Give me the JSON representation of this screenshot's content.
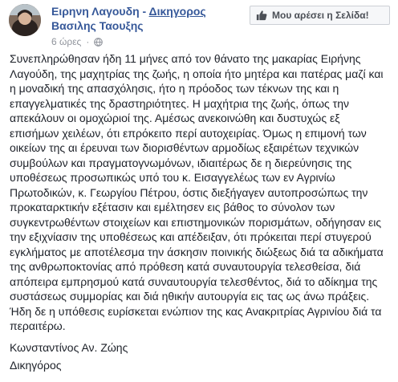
{
  "post": {
    "author_name": "Ειρηνη Λαγουδη",
    "author_separator": " - ",
    "author_role": "Δικηγορος",
    "author_line2": "Βασιλης Ταουξης",
    "time": "6 ώρες",
    "privacy_icon": "globe-icon"
  },
  "like_page_button": {
    "label": "Μου αρέσει η Σελίδα!",
    "icon": "thumbs-up-icon"
  },
  "body": {
    "paragraph1": "Συνεπληρώθησαν ήδη 11 μήνες από τον θάνατο της μακαρίας Ειρήνης\nΛαγούδη, της μαχητρίας της ζωής, η οποία ήτο μητέρα και πατέρας μαζί και\nη μοναδική της απασχόλησις, ήτο η πρόοδος των τέκνων της και η\nεπαγγελματικές της δραστηριότητες. Η μαχήτρια της ζωής, όπως την\nαπεκάλουν οι ομοχώριοί της. Αμέσως ανεκοινώθη και δυστυχώς εξ\nεπισήμων χειλέων, ότι επρόκειτο περί αυτοχειρίας. Όμως η επιμονή των\nοικείων της αι έρευναι των διορισθέντων αρμοδίως εξαιρέτων τεχνικών\nσυμβούλων και πραγματογνωμόνων, ιδιαιτέρως δε η διερεύνησις της\nυποθέσεως προσωπικώς υπό του κ. Εισαγγελέως των εν Αγρινίω\nΠρωτοδικών, κ. Γεωργίου Πέτρου, όστις διεξήγαγεν αυτοπροσώπως την\nπροκαταρκτικήν εξέτασιν και εμέλτησεν εις βάθος το σύνολον των\nσυγκεντρωθέντων στοιχείων και επιστημονικών πορισμάτων, οδήγησαν εις\nτην εξιχνίασιν της υποθέσεως και απέδειξαν, ότι πρόκειται περί στυγερού\nεγκλήματος με αποτέλεσμα την άσκησιν ποινικής διώξεως διά τα αδικήματα\nτης ανθρωποκτονίας από πρόθεση κατά συναυτουργία τελεσθείσα, διά\nαπόπειρα εμπρησμού κατά συναυτουργία τελεσθέντος, διά το αδίκημα της\nσυστάσεως συμμορίας και διά ηθικήν αυτουργία εις τας ως άνω πράξεις.\nΉδη δε η υπόθεσις ευρίσκεται ενώπιον της κας Ανακριτρίας Αγρινίου διά τα\nπεραιτέρω.",
    "signature_name": "Κωνσταντίνος Αν. Ζώης",
    "signature_title": "Δικηγόρος"
  },
  "colors": {
    "link": "#365899",
    "text": "#1d2129",
    "meta": "#90949c"
  }
}
